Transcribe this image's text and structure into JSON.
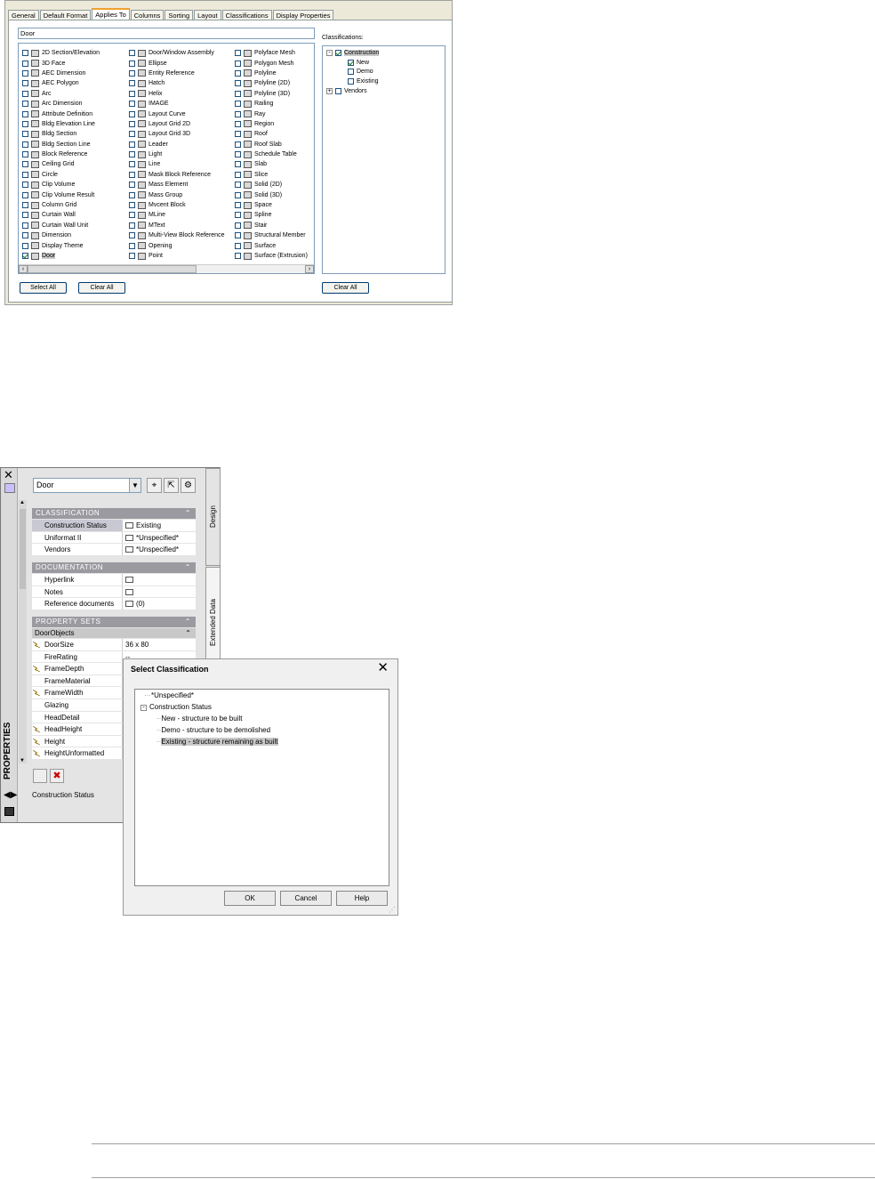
{
  "top_dialog": {
    "tabs": [
      "General",
      "Default Format",
      "Applies To",
      "Columns",
      "Sorting",
      "Layout",
      "Classifications",
      "Display Properties"
    ],
    "active_tab": "Applies To",
    "name_value": "Door",
    "col1": [
      "2D Section/Elevation",
      "3D Face",
      "AEC Dimension",
      "AEC Polygon",
      "Arc",
      "Arc Dimension",
      "Attribute Definition",
      "Bldg Elevation Line",
      "Bldg Section",
      "Bldg Section Line",
      "Block Reference",
      "Ceiling Grid",
      "Circle",
      "Clip Volume",
      "Clip Volume Result",
      "Column Grid",
      "Curtain Wall",
      "Curtain Wall Unit",
      "Dimension",
      "Display Theme",
      "Door"
    ],
    "col2": [
      "Door/Window Assembly",
      "Ellipse",
      "Entity Reference",
      "Hatch",
      "Helix",
      "IMAGE",
      "Layout Curve",
      "Layout Grid 2D",
      "Layout Grid 3D",
      "Leader",
      "Light",
      "Line",
      "Mask Block Reference",
      "Mass Element",
      "Mass Group",
      "Mvcent Block",
      "MLine",
      "MText",
      "Multi-View Block Reference",
      "Opening",
      "Point"
    ],
    "col3": [
      "Polyface Mesh",
      "Polygon Mesh",
      "Polyline",
      "Polyline (2D)",
      "Polyline (3D)",
      "Railing",
      "Ray",
      "Region",
      "Roof",
      "Roof Slab",
      "Schedule Table",
      "Slab",
      "Slice",
      "Solid (2D)",
      "Solid (3D)",
      "Space",
      "Spline",
      "Stair",
      "Structural Member",
      "Surface",
      "Surface (Extrusion)"
    ],
    "select_all_label": "Select All",
    "clear_all_label": "Clear All",
    "classifications_label": "Classifications:",
    "tree": {
      "root": "Construction",
      "children": [
        "New",
        "Demo",
        "Existing"
      ],
      "root2": "Vendors"
    },
    "clear_all_right_label": "Clear All"
  },
  "palette": {
    "vertical_title": "PROPERTIES",
    "combo_value": "Door",
    "sections": {
      "classification": "CLASSIFICATION",
      "documentation": "DOCUMENTATION",
      "property_sets": "PROPERTY SETS"
    },
    "classification_rows": [
      {
        "name": "Construction Status",
        "value": "Existing"
      },
      {
        "name": "Uniformat II",
        "value": "*Unspecified*"
      },
      {
        "name": "Vendors",
        "value": "*Unspecified*"
      }
    ],
    "documentation_rows": [
      {
        "name": "Hyperlink",
        "value": ""
      },
      {
        "name": "Notes",
        "value": ""
      },
      {
        "name": "Reference documents",
        "value": "(0)"
      }
    ],
    "subsection": "DoorObjects",
    "propset_rows": [
      {
        "name": "DoorSize",
        "value": "36 x 80"
      },
      {
        "name": "FireRating",
        "value": "--"
      },
      {
        "name": "FrameDepth",
        "value": ""
      },
      {
        "name": "FrameMaterial",
        "value": ""
      },
      {
        "name": "FrameWidth",
        "value": ""
      },
      {
        "name": "Glazing",
        "value": ""
      },
      {
        "name": "HeadDetail",
        "value": ""
      },
      {
        "name": "HeadHeight",
        "value": ""
      },
      {
        "name": "Height",
        "value": ""
      },
      {
        "name": "HeightUnformatted",
        "value": ""
      }
    ],
    "side_tabs": [
      "Design",
      "Extended Data"
    ],
    "description": "Construction Status"
  },
  "select_dialog": {
    "title": "Select Classification",
    "items": [
      "*Unspecified*",
      "Construction Status",
      "New - structure to be built",
      "Demo - structure to be demolished",
      "Existing - structure remaining as built"
    ],
    "ok_label": "OK",
    "cancel_label": "Cancel",
    "help_label": "Help"
  }
}
